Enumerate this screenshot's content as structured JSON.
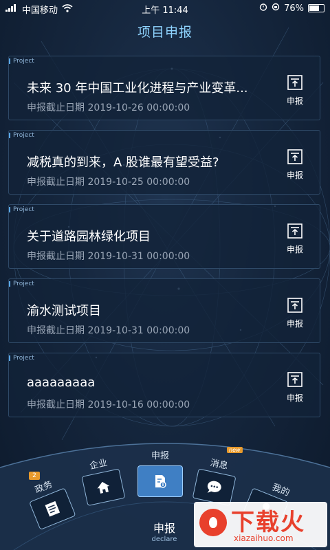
{
  "status_bar": {
    "carrier": "中国移动",
    "time": "上午 11:44",
    "battery": "76%",
    "battery_level": 0.76
  },
  "page": {
    "title": "项目申报"
  },
  "projects": [
    {
      "tag": "Project",
      "title": "未来 30 年中国工业化进程与产业变革...",
      "deadline": "申报截止日期  2019-10-26 00:00:00",
      "action_label": "申报"
    },
    {
      "tag": "Project",
      "title": "减税真的到来，A 股谁最有望受益?",
      "deadline": "申报截止日期  2019-10-25 00:00:00",
      "action_label": "申报"
    },
    {
      "tag": "Project",
      "title": "关于道路园林绿化项目",
      "deadline": "申报截止日期  2019-10-31 00:00:00",
      "action_label": "申报"
    },
    {
      "tag": "Project",
      "title": "渝水测试项目",
      "deadline": "申报截止日期  2019-10-31 00:00:00",
      "action_label": "申报"
    },
    {
      "tag": "Project",
      "title": "aaaaaaaaa",
      "deadline": "申报截止日期  2019-10-16 00:00:00",
      "action_label": "申报"
    }
  ],
  "dock": {
    "items": [
      {
        "label": "政务",
        "badge": "2",
        "icon": "document-list-icon"
      },
      {
        "label": "企业",
        "icon": "home-icon"
      },
      {
        "label": "申报",
        "icon": "declare-file-icon",
        "active": true
      },
      {
        "label": "消息",
        "badge": "new",
        "icon": "chat-bubble-icon"
      },
      {
        "label": "我的",
        "icon": "user-icon"
      }
    ],
    "center_label": "申报",
    "center_sub": "declare"
  },
  "watermark": {
    "text": "下载火",
    "url": "xiazaihuo.com"
  },
  "colors": {
    "title": "#8fd4ff",
    "accent": "#5aa8e8",
    "badge": "#e89a2c",
    "watermark": "#e8402c"
  }
}
